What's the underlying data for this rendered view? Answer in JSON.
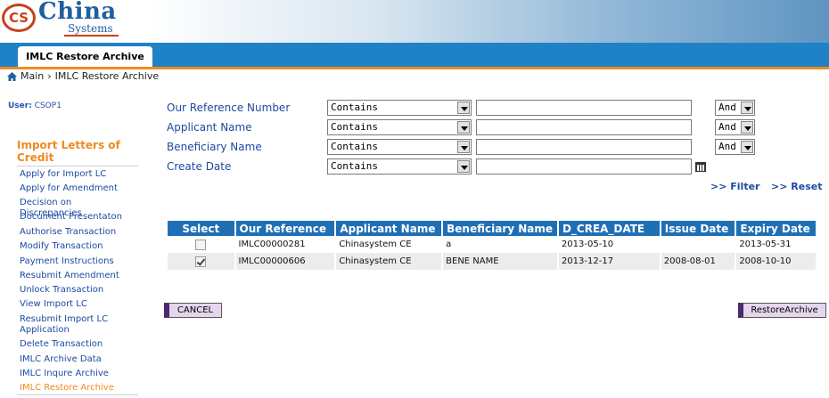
{
  "header": {
    "logo_badge": "CS",
    "logo_name": "China",
    "logo_sub": "Systems",
    "tab_label": "IMLC Restore Archive"
  },
  "breadcrumb": {
    "home": "Main",
    "separator": "›",
    "current": "IMLC Restore Archive"
  },
  "sidebar": {
    "user_label": "User:",
    "user_value": "CSOP1",
    "section_title": "Import Letters of Credit",
    "items": [
      {
        "label": "Apply for Import LC"
      },
      {
        "label": "Apply for Amendment"
      },
      {
        "label": "Decision on Discrepancies"
      },
      {
        "label": "Document Presentaton"
      },
      {
        "label": "Authorise Transaction"
      },
      {
        "label": "Modify Transaction"
      },
      {
        "label": "Payment Instructions"
      },
      {
        "label": "Resubmit Amendment"
      },
      {
        "label": "Unlock Transaction"
      },
      {
        "label": "View Import LC"
      },
      {
        "label": "Resubmit Import LC Application"
      },
      {
        "label": "Delete Transaction"
      },
      {
        "label": "IMLC Archive Data"
      },
      {
        "label": "IMLC Inqure Archive"
      },
      {
        "label": "IMLC Restore Archive",
        "active": true
      }
    ]
  },
  "filters": [
    {
      "label": "Our Reference Number",
      "operator": "Contains",
      "value": "",
      "conjunction": "And"
    },
    {
      "label": "Applicant Name",
      "operator": "Contains",
      "value": "",
      "conjunction": "And"
    },
    {
      "label": "Beneficiary Name",
      "operator": "Contains",
      "value": "",
      "conjunction": "And"
    },
    {
      "label": "Create Date",
      "operator": "Contains",
      "value": ""
    }
  ],
  "actions": {
    "filter": ">> Filter",
    "reset": ">> Reset",
    "cancel": "CANCEL",
    "restore": "RestoreArchive"
  },
  "table": {
    "columns": [
      "Select",
      "Our Reference",
      "Applicant Name",
      "Beneficiary Name",
      "D_CREA_DATE",
      "Issue Date",
      "Expiry Date"
    ],
    "rows": [
      {
        "selected": false,
        "cells": [
          "IMLC00000281",
          "Chinasystem CE",
          "a",
          "2013-05-10",
          "",
          "2013-05-31"
        ]
      },
      {
        "selected": true,
        "cells": [
          "IMLC00000606",
          "Chinasystem CE",
          "BENE NAME",
          "2013-12-17",
          "2008-08-01",
          "2008-10-10"
        ]
      }
    ]
  },
  "colors": {
    "accent_orange": "#ef8a22",
    "header_blue": "#1f82c6",
    "table_header": "#1f6fb5",
    "link_blue": "#1c4aa0"
  }
}
